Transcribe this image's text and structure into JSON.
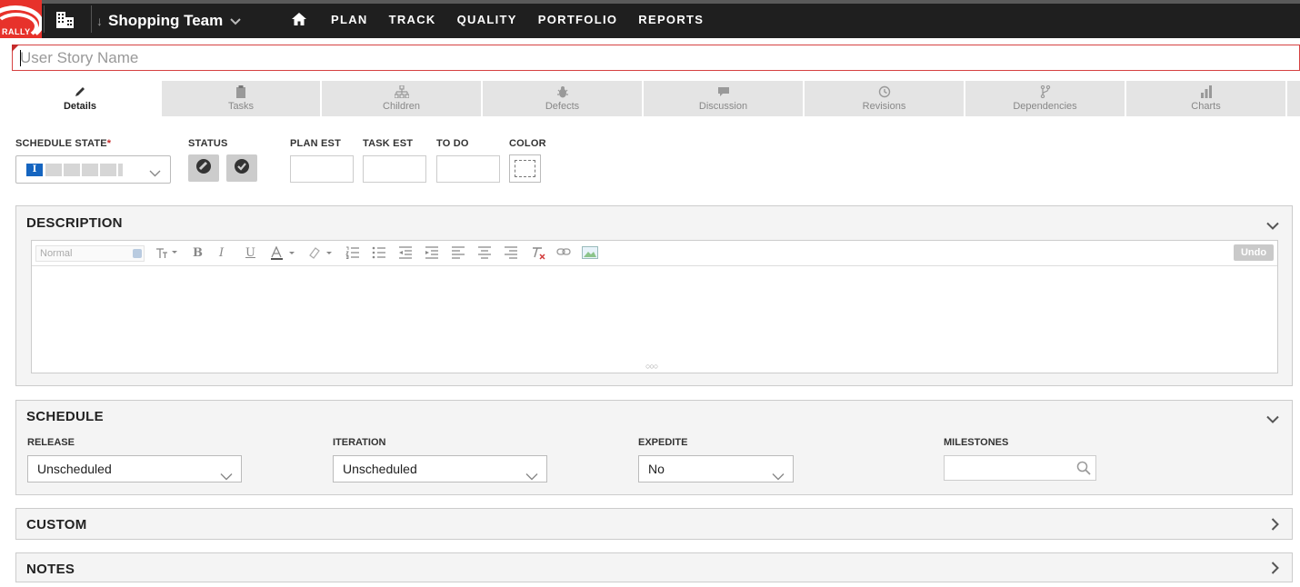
{
  "header": {
    "logo_text": "RALLY",
    "team": "Shopping Team",
    "nav": [
      "PLAN",
      "TRACK",
      "QUALITY",
      "PORTFOLIO",
      "REPORTS"
    ]
  },
  "story": {
    "name_placeholder": "User Story Name",
    "name_value": ""
  },
  "tabs": [
    {
      "label": "Details",
      "icon": "pencil-icon",
      "active": true
    },
    {
      "label": "Tasks",
      "icon": "clipboard-icon"
    },
    {
      "label": "Children",
      "icon": "hierarchy-icon"
    },
    {
      "label": "Defects",
      "icon": "bug-icon"
    },
    {
      "label": "Discussion",
      "icon": "comment-icon"
    },
    {
      "label": "Revisions",
      "icon": "history-icon"
    },
    {
      "label": "Dependencies",
      "icon": "branch-icon"
    },
    {
      "label": "Charts",
      "icon": "bar-chart-icon"
    }
  ],
  "fields": {
    "schedule_state_label": "SCHEDULE STATE",
    "schedule_state_required": "*",
    "schedule_state_value": "I",
    "status_label": "STATUS",
    "plan_est_label": "PLAN EST",
    "task_est_label": "TASK EST",
    "to_do_label": "TO DO",
    "color_label": "COLOR"
  },
  "description": {
    "title": "DESCRIPTION",
    "format_value": "Normal",
    "undo_label": "Undo",
    "resize_glyph": "○○○"
  },
  "schedule": {
    "title": "SCHEDULE",
    "release_label": "RELEASE",
    "release_value": "Unscheduled",
    "iteration_label": "ITERATION",
    "iteration_value": "Unscheduled",
    "expedite_label": "EXPEDITE",
    "expedite_value": "No",
    "milestones_label": "MILESTONES"
  },
  "custom": {
    "title": "CUSTOM"
  },
  "notes": {
    "title": "NOTES"
  },
  "colors": {
    "topbar": "#1f1f1f",
    "brand_red": "#e7322b",
    "accent_blue": "#1565c0"
  }
}
